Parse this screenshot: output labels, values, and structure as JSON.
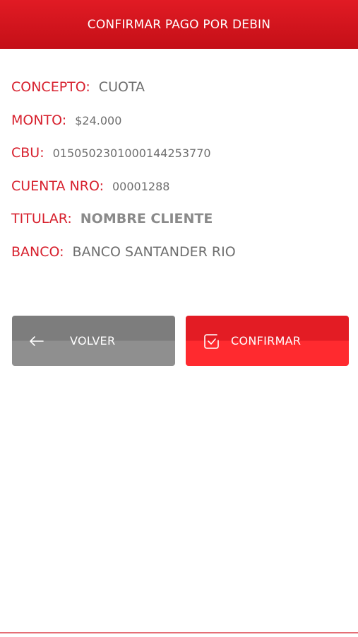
{
  "header": {
    "title": "CONFIRMAR PAGO POR DEBIN"
  },
  "details": [
    {
      "label": "CONCEPTO:",
      "value": "CUOTA"
    },
    {
      "label": "MONTO:",
      "value": "$24.000"
    },
    {
      "label": "CBU:",
      "value": "0150502301000144253770"
    },
    {
      "label": "CUENTA NRO:",
      "value": "00001288"
    },
    {
      "label": "TITULAR:",
      "value": "NOMBRE CLIENTE"
    },
    {
      "label": "BANCO:",
      "value": "BANCO SANTANDER RIO"
    }
  ],
  "actions": {
    "back_label": "VOLVER",
    "confirm_label": "CONFIRMAR",
    "back_icon": "arrow-left-icon",
    "confirm_icon": "checkbox-check-icon"
  },
  "colors": {
    "brand_red": "#d7202d",
    "header_red": "#e11b24",
    "button_gray": "#7d7d7d",
    "text_gray": "#6e6e6e"
  }
}
